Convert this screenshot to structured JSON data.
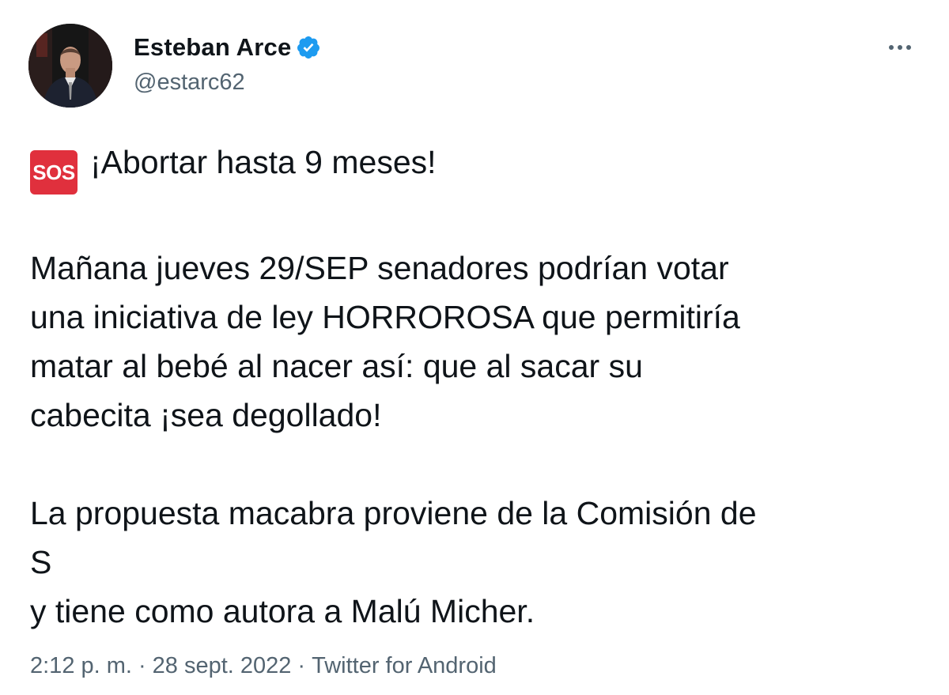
{
  "author": {
    "name": "Esteban Arce",
    "handle": "@estarc62",
    "verified": true,
    "avatar_icon": "person-avatar-icon"
  },
  "menu_icon": "more-options-icon",
  "tweet": {
    "emoji": "SOS",
    "lines": [
      "¡Abortar hasta 9 meses!",
      "Mañana jueves 29/SEP senadores podrían votar\nuna iniciativa de ley HORROROSA que permitiría\nmatar al bebé al nacer así: que al sacar su\ncabecita ¡sea degollado!",
      "La propuesta macabra proviene de la Comisión de\nS\ny tiene como autora a Malú Micher."
    ]
  },
  "meta": {
    "time": "2:12 p. m.",
    "date": "28 sept. 2022",
    "source": "Twitter for Android",
    "separator": "·"
  },
  "colors": {
    "text": "#0f1419",
    "secondary": "#536471",
    "verified": "#1d9bf0",
    "sos": "#e0303d"
  }
}
